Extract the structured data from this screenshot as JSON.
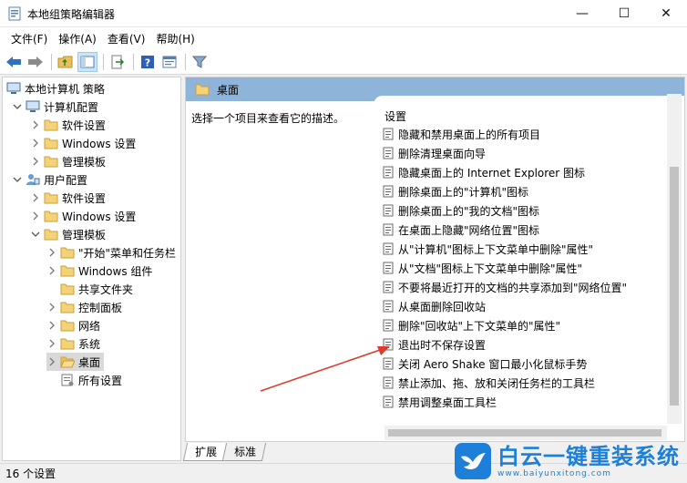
{
  "window": {
    "title": "本地组策略编辑器",
    "minimize": "—",
    "maximize": "☐",
    "close": "✕"
  },
  "menu": [
    "文件(F)",
    "操作(A)",
    "查看(V)",
    "帮助(H)"
  ],
  "tree": [
    {
      "label": "本地计算机 策略",
      "level": 0,
      "chevron": "none",
      "icon": "computer-icon"
    },
    {
      "label": "计算机配置",
      "level": 1,
      "chevron": "down",
      "icon": "computer-icon"
    },
    {
      "label": "软件设置",
      "level": 2,
      "chevron": "right",
      "icon": "folder-icon"
    },
    {
      "label": "Windows 设置",
      "level": 2,
      "chevron": "right",
      "icon": "folder-icon"
    },
    {
      "label": "管理模板",
      "level": 2,
      "chevron": "right",
      "icon": "folder-icon"
    },
    {
      "label": "用户配置",
      "level": 1,
      "chevron": "down",
      "icon": "user-icon"
    },
    {
      "label": "软件设置",
      "level": 2,
      "chevron": "right",
      "icon": "folder-icon"
    },
    {
      "label": "Windows 设置",
      "level": 2,
      "chevron": "right",
      "icon": "folder-icon"
    },
    {
      "label": "管理模板",
      "level": 2,
      "chevron": "down",
      "icon": "folder-icon"
    },
    {
      "label": "\"开始\"菜单和任务栏",
      "level": 3,
      "chevron": "right",
      "icon": "folder-icon"
    },
    {
      "label": "Windows 组件",
      "level": 3,
      "chevron": "right",
      "icon": "folder-icon"
    },
    {
      "label": "共享文件夹",
      "level": 3,
      "chevron": "none",
      "icon": "folder-icon"
    },
    {
      "label": "控制面板",
      "level": 3,
      "chevron": "right",
      "icon": "folder-icon"
    },
    {
      "label": "网络",
      "level": 3,
      "chevron": "right",
      "icon": "folder-icon"
    },
    {
      "label": "系统",
      "level": 3,
      "chevron": "right",
      "icon": "folder-icon"
    },
    {
      "label": "桌面",
      "level": 3,
      "chevron": "right",
      "icon": "folder-open-icon",
      "selected": true
    },
    {
      "label": "所有设置",
      "level": 3,
      "chevron": "none",
      "icon": "settings-page-icon"
    }
  ],
  "right": {
    "header": "桌面",
    "description": "选择一个项目来查看它的描述。",
    "column": "设置",
    "settings": [
      "隐藏和禁用桌面上的所有项目",
      "删除清理桌面向导",
      "隐藏桌面上的 Internet Explorer 图标",
      "删除桌面上的\"计算机\"图标",
      "删除桌面上的\"我的文档\"图标",
      "在桌面上隐藏\"网络位置\"图标",
      "从\"计算机\"图标上下文菜单中删除\"属性\"",
      "从\"文档\"图标上下文菜单中删除\"属性\"",
      "不要将最近打开的文档的共享添加到\"网络位置\"",
      "从桌面删除回收站",
      "删除\"回收站\"上下文菜单的\"属性\"",
      "退出时不保存设置",
      "关闭 Aero Shake 窗口最小化鼠标手势",
      "禁止添加、拖、放和关闭任务栏的工具栏",
      "禁用调整桌面工具栏"
    ]
  },
  "tabs": [
    "扩展",
    "标准"
  ],
  "status": "16 个设置",
  "watermark": {
    "cn": "白云一键重装系统",
    "en": "www.baiyunxitong.com"
  },
  "colors": {
    "header": "#8fb4d9",
    "selection": "#d9d9d9",
    "arrow": "#e03a2e",
    "brand": "#1e7fd8"
  }
}
